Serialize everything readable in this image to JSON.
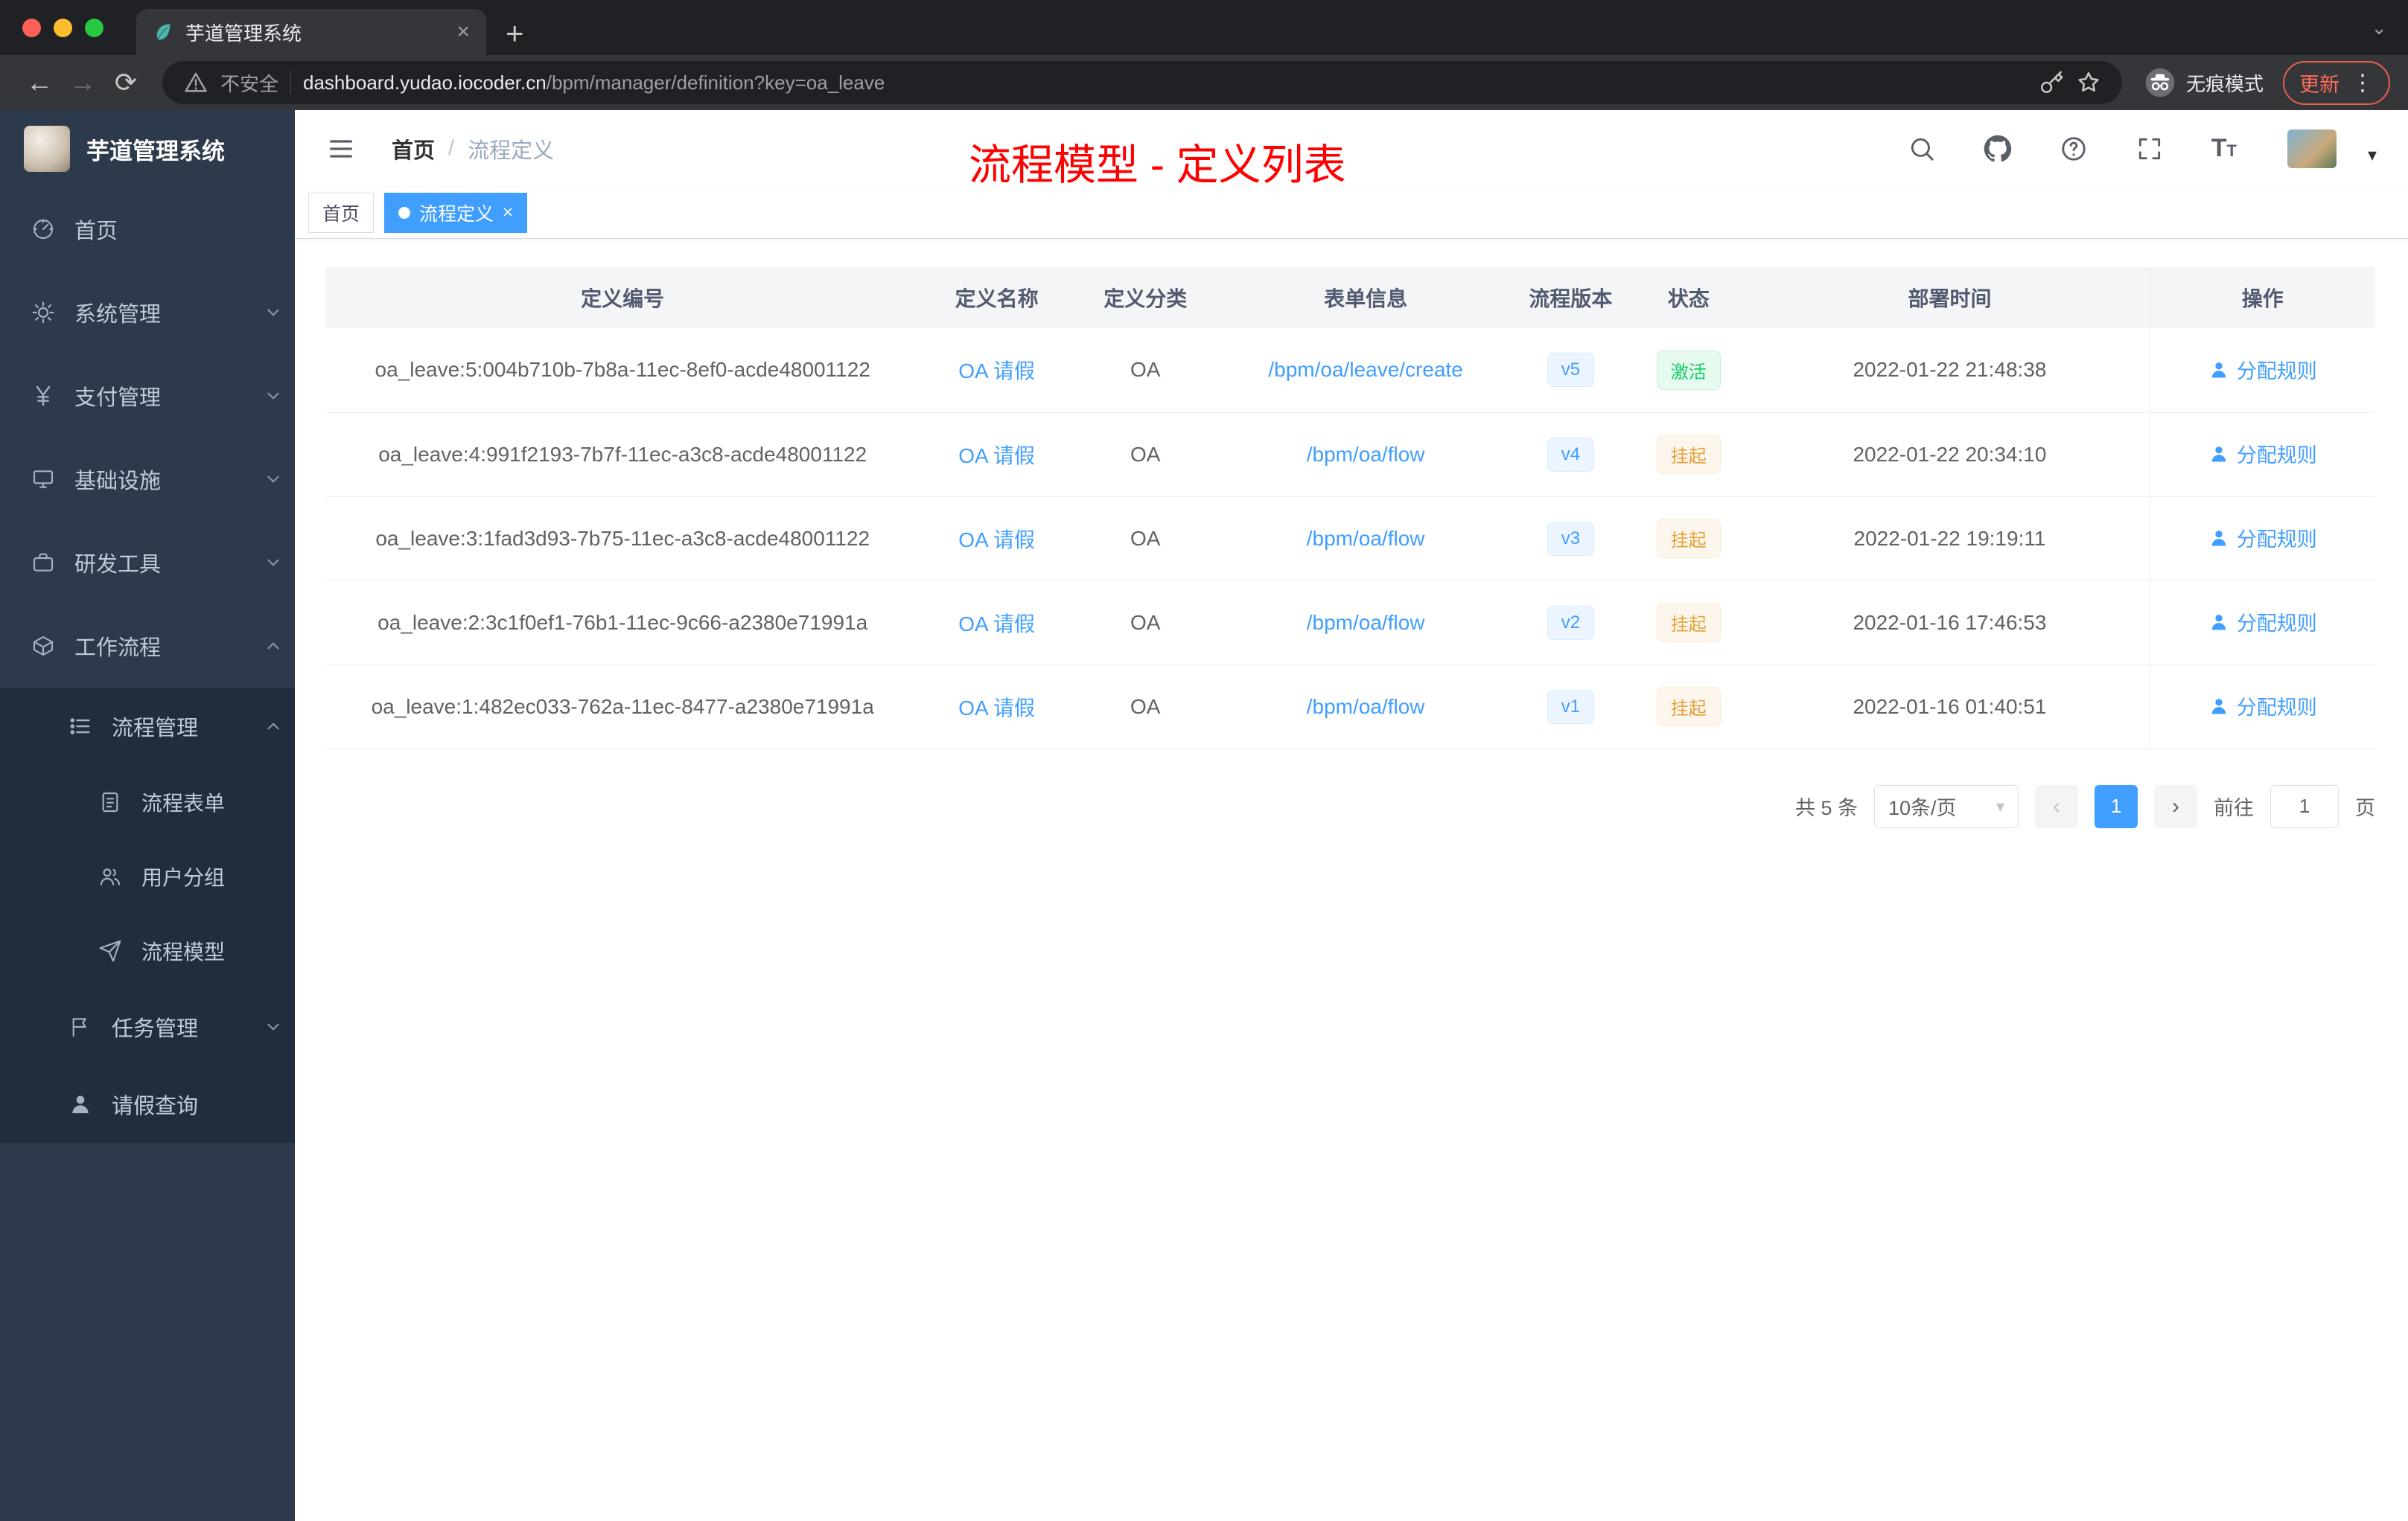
{
  "icons": {
    "close": "×",
    "plus": "+",
    "dots": "⋮",
    "caret_down": "▾",
    "prev": "‹",
    "next": "›",
    "tab_search": "⌄"
  },
  "browser": {
    "tab_title": "芋道管理系统",
    "security_label": "不安全",
    "url_host": "dashboard.yudao.iocoder.cn",
    "url_path": "/bpm/manager/definition?key=oa_leave",
    "incognito_label": "无痕模式",
    "update_label": "更新"
  },
  "sidebar": {
    "title": "芋道管理系统",
    "items": [
      {
        "label": "首页"
      },
      {
        "label": "系统管理"
      },
      {
        "label": "支付管理"
      },
      {
        "label": "基础设施"
      },
      {
        "label": "研发工具"
      },
      {
        "label": "工作流程"
      },
      {
        "label": "流程管理"
      },
      {
        "label": "流程表单"
      },
      {
        "label": "用户分组"
      },
      {
        "label": "流程模型"
      },
      {
        "label": "任务管理"
      },
      {
        "label": "请假查询"
      }
    ]
  },
  "header": {
    "breadcrumb_home": "首页",
    "breadcrumb_sep": "/",
    "breadcrumb_current": "流程定义",
    "annotation": "流程模型 - 定义列表"
  },
  "tags": {
    "home": "首页",
    "active": "流程定义"
  },
  "table": {
    "columns": [
      "定义编号",
      "定义名称",
      "定义分类",
      "表单信息",
      "流程版本",
      "状态",
      "部署时间",
      "操作"
    ],
    "rows": [
      {
        "id": "oa_leave:5:004b710b-7b8a-11ec-8ef0-acde48001122",
        "name": "OA 请假",
        "category": "OA",
        "form": "/bpm/oa/leave/create",
        "version": "v5",
        "status": "激活",
        "status_type": "success",
        "deploy_time": "2022-01-22 21:48:38",
        "action": "分配规则"
      },
      {
        "id": "oa_leave:4:991f2193-7b7f-11ec-a3c8-acde48001122",
        "name": "OA 请假",
        "category": "OA",
        "form": "/bpm/oa/flow",
        "version": "v4",
        "status": "挂起",
        "status_type": "warning",
        "deploy_time": "2022-01-22 20:34:10",
        "action": "分配规则"
      },
      {
        "id": "oa_leave:3:1fad3d93-7b75-11ec-a3c8-acde48001122",
        "name": "OA 请假",
        "category": "OA",
        "form": "/bpm/oa/flow",
        "version": "v3",
        "status": "挂起",
        "status_type": "warning",
        "deploy_time": "2022-01-22 19:19:11",
        "action": "分配规则"
      },
      {
        "id": "oa_leave:2:3c1f0ef1-76b1-11ec-9c66-a2380e71991a",
        "name": "OA 请假",
        "category": "OA",
        "form": "/bpm/oa/flow",
        "version": "v2",
        "status": "挂起",
        "status_type": "warning",
        "deploy_time": "2022-01-16 17:46:53",
        "action": "分配规则"
      },
      {
        "id": "oa_leave:1:482ec033-762a-11ec-8477-a2380e71991a",
        "name": "OA 请假",
        "category": "OA",
        "form": "/bpm/oa/flow",
        "version": "v1",
        "status": "挂起",
        "status_type": "warning",
        "deploy_time": "2022-01-16 01:40:51",
        "action": "分配规则"
      }
    ]
  },
  "pagination": {
    "total": "共 5 条",
    "page_size": "10条/页",
    "current_page": "1",
    "goto_label": "前往",
    "goto_value": "1",
    "page_unit": "页"
  }
}
